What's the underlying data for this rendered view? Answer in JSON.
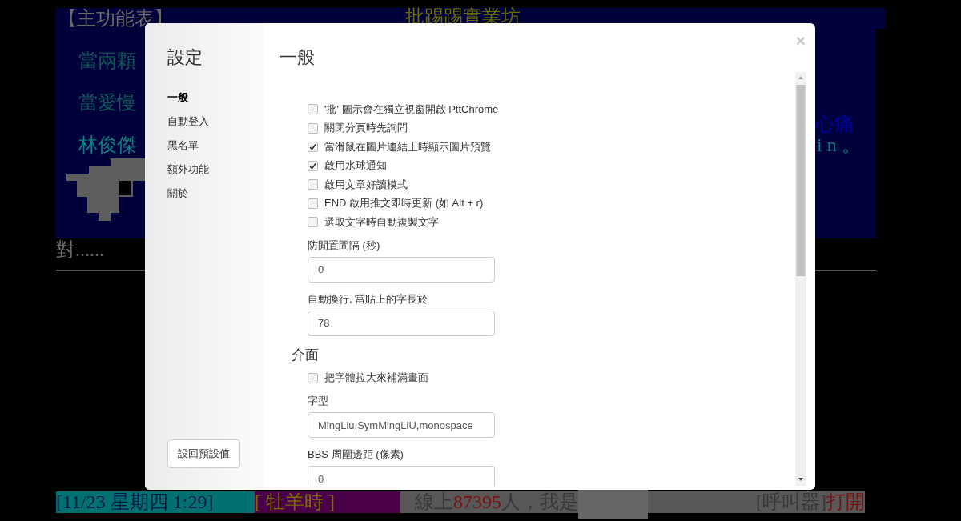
{
  "terminal": {
    "title": "【主功能表】",
    "board_name": "批踢踢實業坊",
    "lines": [
      {
        "text": "當兩顆",
        "color": "#0b5a5a"
      },
      {
        "text": "當愛慢",
        "color": "#0b5a5a"
      },
      {
        "text": "心痛",
        "color": "#0000a8"
      },
      {
        "text": "林俊傑",
        "color": "#0b8080"
      },
      {
        "text": "in。",
        "color": "#0b8080"
      },
      {
        "text": "對......",
        "color": "#707070"
      }
    ],
    "status_bar": {
      "date": "[11/23 星期四 1:29]",
      "zodiac": "[ 牡羊時 ]",
      "online_prefix": "線上",
      "online_count": "87395",
      "online_suffix": "人，我是",
      "pager_label": "[呼叫器]",
      "pager_state": "打開"
    }
  },
  "modal": {
    "title": "設定",
    "nav": [
      {
        "label": "一般",
        "selected": true
      },
      {
        "label": "自動登入",
        "selected": false
      },
      {
        "label": "黑名單",
        "selected": false
      },
      {
        "label": "額外功能",
        "selected": false
      },
      {
        "label": "關於",
        "selected": false
      }
    ],
    "reset_button": "設回預設值",
    "close": "×",
    "heading": "一般",
    "items": [
      {
        "kind": "checkbox",
        "label": "'批' 圖示會在獨立視窗開啟 PttChrome",
        "checked": false
      },
      {
        "kind": "checkbox",
        "label": "關閉分頁時先詢問",
        "checked": false
      },
      {
        "kind": "checkbox",
        "label": "當滑鼠在圖片連結上時顯示圖片預覽",
        "checked": true
      },
      {
        "kind": "checkbox",
        "label": "啟用水球通知",
        "checked": true
      },
      {
        "kind": "checkbox",
        "label": "啟用文章好讀模式",
        "checked": false
      },
      {
        "kind": "checkbox",
        "label": "END 啟用推文即時更新 (如 Alt + r)",
        "checked": false
      },
      {
        "kind": "checkbox",
        "label": "選取文字時自動複製文字",
        "checked": false
      },
      {
        "kind": "field",
        "label": "防閒置間隔 (秒)",
        "value": "0"
      },
      {
        "kind": "field",
        "label": "自動換行, 當貼上的字長於",
        "value": "78"
      },
      {
        "kind": "heading",
        "label": "介面"
      },
      {
        "kind": "checkbox",
        "label": "把字體拉大來補滿畫面",
        "checked": false
      },
      {
        "kind": "field",
        "label": "字型",
        "value": "MingLiu,SymMingLiU,monospace"
      },
      {
        "kind": "field",
        "label": "BBS 周圍邊距 (像素)",
        "value": "0"
      }
    ]
  }
}
